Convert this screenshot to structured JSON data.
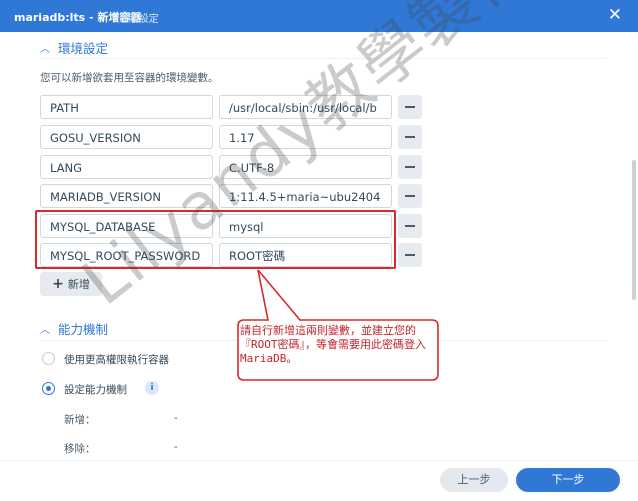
{
  "window": {
    "title": "mariadb:lts - 新增容器",
    "subtitle": "- 進階設定",
    "close_icon": "close-icon"
  },
  "env_section": {
    "title": "環境設定",
    "description": "您可以新增欲套用至容器的環境變數。",
    "variables": [
      {
        "name": "PATH",
        "value": "/usr/local/sbin:/usr/local/b"
      },
      {
        "name": "GOSU_VERSION",
        "value": "1.17"
      },
      {
        "name": "LANG",
        "value": "C.UTF-8"
      },
      {
        "name": "MARIADB_VERSION",
        "value": "1:11.4.5+maria~ubu2404"
      },
      {
        "name": "MYSQL_DATABASE",
        "value": "mysql"
      },
      {
        "name": "MYSQL_ROOT_PASSWORD",
        "value": "ROOT密碼"
      }
    ],
    "add_label": "新增"
  },
  "capability_section": {
    "title": "能力機制",
    "options": [
      {
        "label": "使用更高權限執行容器",
        "selected": false
      },
      {
        "label": "設定能力機制",
        "selected": true
      }
    ],
    "add_label": "新增：",
    "add_value": "-",
    "remove_label": "移除：",
    "remove_value": "-"
  },
  "annotation": {
    "text": "請自行新增這兩則變數，並建立您的『ROOT密碼』，等會需要用此密碼登入MariaDB。",
    "color": "#d62b2b"
  },
  "watermark": "Lilyandy教學製作",
  "footer": {
    "prev_label": "上一步",
    "next_label": "下一步"
  },
  "colors": {
    "accent": "#2f78d6",
    "highlight": "#d62b2b"
  }
}
